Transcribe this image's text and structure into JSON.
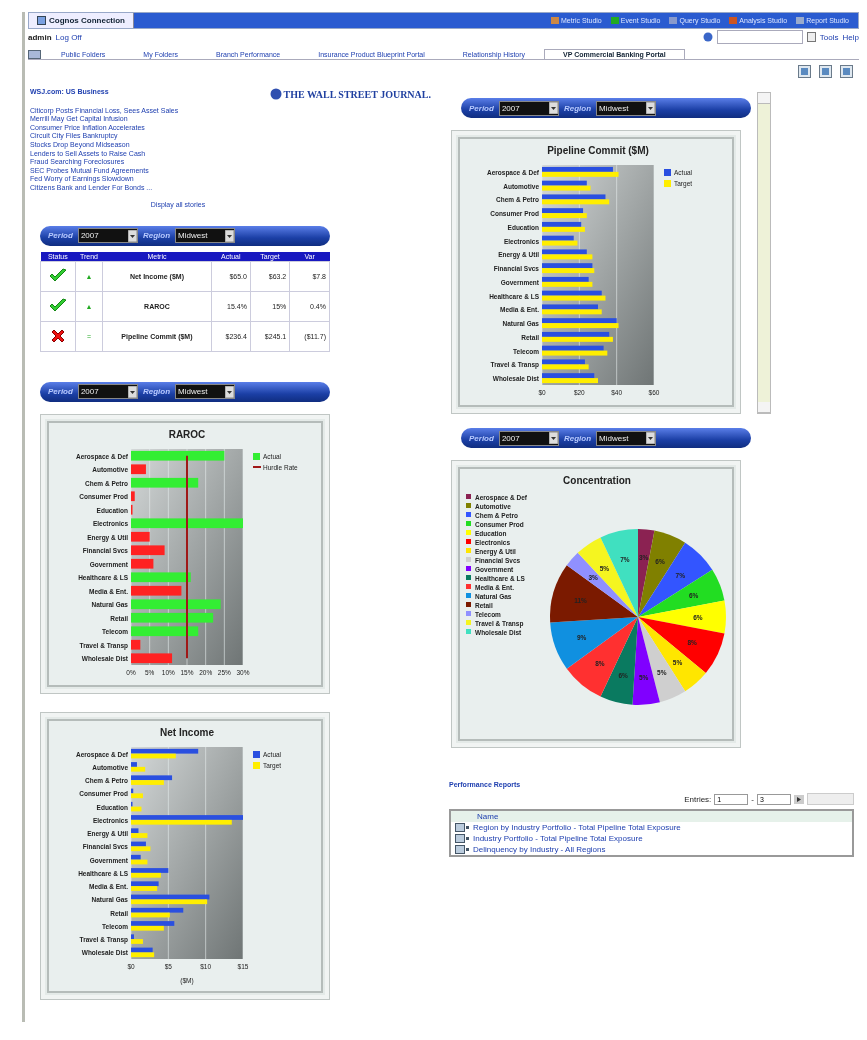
{
  "app_bar": {
    "title": "Cognos Connection",
    "links": [
      "Metric Studio",
      "Event Studio",
      "Query Studio",
      "Analysis Studio",
      "Report Studio"
    ]
  },
  "user_bar": {
    "user": "admin",
    "log_off": "Log Off",
    "menus": [
      "Tools",
      "Help"
    ]
  },
  "tabs": [
    {
      "label": "Public Folders",
      "selected": false
    },
    {
      "label": "My Folders",
      "selected": false
    },
    {
      "label": "Branch Performance",
      "selected": false
    },
    {
      "label": "Insurance Product Blueprint Portal",
      "selected": false
    },
    {
      "label": "Relationship History",
      "selected": false
    },
    {
      "label": "VP Commercial Banking Portal",
      "selected": true
    }
  ],
  "news": {
    "heading": "WSJ.com: US Business",
    "logo": "THE WALL STREET JOURNAL.",
    "headlines": [
      "Citicorp Posts Financial Loss, Sees Asset Sales",
      "Merrill May Get Capital Infusion",
      "Consumer Price Inflation Accelerates",
      "Circuit City Files Bankruptcy",
      "Stocks Drop Beyond Midseason",
      "Lenders to Sell Assets to Raise Cash",
      "Fraud Searching Foreclosures",
      "SEC Probes Mutual Fund Agreements",
      "Fed Worry of Earnings Slowdown",
      "Citizens Bank and Lender For Bonds ..."
    ],
    "more": "Display all stories"
  },
  "kpi": {
    "filters": {
      "period_label": "Period",
      "period": "2007",
      "region_label": "Region",
      "region": "Midwest"
    },
    "columns": [
      "Status",
      "Trend",
      "Metric",
      "Actual",
      "Target",
      "Var"
    ],
    "rows": [
      {
        "kind": "ok",
        "trend": "▲",
        "metric": "Net Income ($M)",
        "actual": "$65.0",
        "target": "$63.2",
        "var": "$7.8"
      },
      {
        "kind": "ok",
        "trend": "▲",
        "metric": "RAROC",
        "actual": "15.4%",
        "target": "15%",
        "var": "0.4%"
      },
      {
        "kind": "fail",
        "trend": "=",
        "metric": "Pipeline Commit ($M)",
        "actual": "$236.4",
        "target": "$245.1",
        "var": "($11.7)"
      }
    ]
  },
  "raroc": {
    "filters": {
      "period_label": "Period",
      "period": "2007",
      "region_label": "Region",
      "region": "Midwest"
    },
    "chart_data": {
      "type": "bar",
      "orientation": "horizontal",
      "title": "RAROC",
      "categories": [
        "Aerospace & Def",
        "Automotive",
        "Chem & Petro",
        "Consumer Prod",
        "Education",
        "Electronics",
        "Energy & Util",
        "Financial Svcs",
        "Government",
        "Healthcare & LS",
        "Media & Ent.",
        "Natural Gas",
        "Retail",
        "Telecom",
        "Travel & Transp",
        "Wholesale Dist"
      ],
      "series": [
        {
          "name": "Actual",
          "color": "#33ee33",
          "values": [
            25,
            null,
            18,
            null,
            null,
            30,
            null,
            null,
            null,
            16,
            null,
            24,
            22,
            18,
            null,
            null
          ]
        },
        {
          "color": "#ff2222",
          "values": [
            null,
            4,
            null,
            1,
            0.4,
            null,
            5,
            9,
            6,
            null,
            13.5,
            null,
            null,
            null,
            2.5,
            11
          ]
        },
        {
          "name": "Hurdle Rate",
          "type": "line",
          "color": "#a01818",
          "values": [
            15,
            15,
            15,
            15,
            15,
            15,
            15,
            15,
            15,
            15,
            15,
            15,
            15,
            15,
            15,
            15
          ]
        }
      ],
      "stacked": true,
      "grid": true,
      "legend": "right",
      "xlim": [
        0,
        30
      ],
      "xticks": [
        {
          "value": 0,
          "label": "0%"
        },
        {
          "value": 5,
          "label": "5%"
        },
        {
          "value": 10,
          "label": "10%"
        },
        {
          "value": 15,
          "label": "15%"
        },
        {
          "value": 20,
          "label": "20%"
        },
        {
          "value": 25,
          "label": "25%"
        },
        {
          "value": 30,
          "label": "30%"
        }
      ]
    }
  },
  "net_income": {
    "chart_data": {
      "type": "bar",
      "orientation": "horizontal",
      "title": "Net Income",
      "xlabel": "($M)",
      "categories": [
        "Aerospace & Def",
        "Automotive",
        "Chem & Petro",
        "Consumer Prod",
        "Education",
        "Electronics",
        "Energy & Util",
        "Financial Svcs",
        "Government",
        "Healthcare & LS",
        "Media & Ent.",
        "Natural Gas",
        "Retail",
        "Telecom",
        "Travel & Transp",
        "Wholesale Dist"
      ],
      "series": [
        {
          "name": "Actual",
          "color": "#2a4fe0",
          "values": [
            9,
            0.8,
            5.5,
            0.3,
            0.2,
            15,
            1,
            2,
            1.3,
            5,
            3.7,
            10.5,
            7,
            5.8,
            0.4,
            2.9
          ]
        },
        {
          "name": "Target",
          "color": "#ffee00",
          "values": [
            6,
            1.9,
            4.4,
            1.6,
            1.4,
            13.5,
            2.2,
            2.6,
            2.2,
            4,
            3.5,
            10.2,
            5.2,
            4.4,
            1.6,
            3.1
          ]
        }
      ],
      "grid": true,
      "legend": "right",
      "xlim": [
        0,
        15
      ],
      "xticks": [
        {
          "value": 0,
          "label": "$0"
        },
        {
          "value": 5,
          "label": "$5"
        },
        {
          "value": 10,
          "label": "$10"
        },
        {
          "value": 15,
          "label": "$15"
        }
      ]
    }
  },
  "pipeline": {
    "filters": {
      "period_label": "Period",
      "period": "2007",
      "region_label": "Region",
      "region": "Midwest"
    },
    "chart_data": {
      "type": "bar",
      "orientation": "horizontal",
      "title": "Pipeline Commit ($M)",
      "categories": [
        "Aerospace & Def",
        "Automotive",
        "Chem & Petro",
        "Consumer Prod",
        "Education",
        "Electronics",
        "Energy & Util",
        "Financial Svcs",
        "Government",
        "Healthcare & LS",
        "Media & Ent.",
        "Natural Gas",
        "Retail",
        "Telecom",
        "Travel & Transp",
        "Wholesale Dist"
      ],
      "series": [
        {
          "name": "Actual",
          "color": "#2a4fe0",
          "values": [
            38,
            24,
            34,
            22,
            21,
            17,
            24,
            27,
            25,
            32,
            30,
            40,
            36,
            33,
            23,
            28
          ]
        },
        {
          "name": "Target",
          "color": "#ffee00",
          "values": [
            41,
            26,
            36,
            24,
            23,
            19,
            27,
            28,
            27,
            34,
            32,
            41,
            38,
            35,
            25,
            30
          ]
        }
      ],
      "grid": true,
      "legend": "right",
      "xlim": [
        0,
        60
      ],
      "xticks": [
        {
          "value": 0,
          "label": "$0"
        },
        {
          "value": 20,
          "label": "$20"
        },
        {
          "value": 40,
          "label": "$40"
        },
        {
          "value": 60,
          "label": "$60"
        }
      ]
    }
  },
  "concentration": {
    "filters": {
      "period_label": "Period",
      "period": "2007",
      "region_label": "Region",
      "region": "Midwest"
    },
    "chart_data": {
      "type": "pie",
      "title": "Concentration",
      "legend": "left",
      "categories": [
        "Aerospace & Def",
        "Automotive",
        "Chem & Petro",
        "Consumer Prod",
        "Education",
        "Electronics",
        "Energy & Util",
        "Financial Svcs",
        "Government",
        "Healthcare & LS",
        "Media & Ent.",
        "Natural Gas",
        "Retail",
        "Telecom",
        "Travel & Transp",
        "Wholesale Dist"
      ],
      "values": [
        3,
        6,
        7,
        6,
        6,
        8,
        5,
        5,
        5,
        6,
        8,
        9,
        11,
        3,
        5,
        7
      ],
      "colors": [
        "#8b2252",
        "#808000",
        "#3355ff",
        "#22dd22",
        "#ffff00",
        "#ff0000",
        "#ffe600",
        "#cfcfcf",
        "#8000ff",
        "#0a7a60",
        "#ff3030",
        "#1090e0",
        "#7b1a00",
        "#9090ff",
        "#f5f520",
        "#40e0c0"
      ],
      "value_labels": [
        "3%",
        "6%",
        "7%",
        "6%",
        "6%",
        "8%",
        "5%",
        "5%",
        "5%",
        "6%",
        "8%",
        "9%",
        "11%",
        "3%",
        "5%",
        "7%"
      ]
    }
  },
  "reports": {
    "title": "Performance Reports",
    "entries_label": "Entries:",
    "from": "1",
    "dash": "-",
    "to": "3",
    "column": "Name",
    "rows": [
      "Region by Industry Portfolio - Total Pipeline Total Exposure",
      "Industry Portfolio - Total Pipeline Total Exposure",
      "Delinquency by Industry - All Regions"
    ]
  }
}
